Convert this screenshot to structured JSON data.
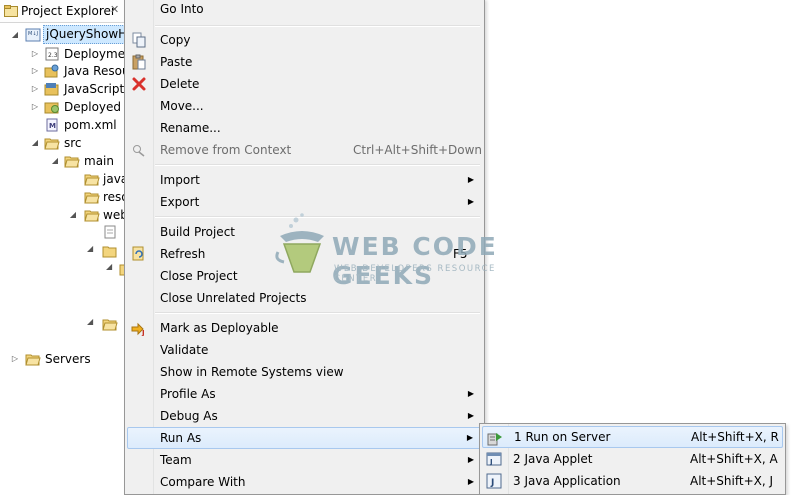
{
  "explorer": {
    "title": "Project Explorer",
    "close_glyph": "✕",
    "project": "jQueryShowHid",
    "nodes": {
      "deployment": "Deploymen",
      "java_resources": "Java Resour",
      "javascript": "JavaScript R",
      "deployed": "Deployed R",
      "pom": "pom.xml",
      "src": "src",
      "main": "main",
      "java": "java",
      "resources": "reso",
      "webapp": "web",
      "servers": "Servers"
    }
  },
  "menu": {
    "go_into": "Go Into",
    "copy": "Copy",
    "paste": "Paste",
    "delete": "Delete",
    "move": "Move...",
    "rename": "Rename...",
    "remove_from_context": "Remove from Context",
    "remove_shortcut": "Ctrl+Alt+Shift+Down",
    "import": "Import",
    "export": "Export",
    "build_project": "Build Project",
    "refresh": "Refresh",
    "refresh_shortcut": "F5",
    "close_project": "Close Project",
    "close_unrelated": "Close Unrelated Projects",
    "mark_deployable": "Mark as Deployable",
    "validate": "Validate",
    "show_remote": "Show in Remote Systems view",
    "profile_as": "Profile As",
    "debug_as": "Debug As",
    "run_as": "Run As",
    "team": "Team",
    "compare_with": "Compare With",
    "submenu_arrow": "▶"
  },
  "submenu": {
    "items": [
      {
        "label": "1 Run on Server",
        "shortcut": "Alt+Shift+X, R"
      },
      {
        "label": "2 Java Applet",
        "shortcut": "Alt+Shift+X, A"
      },
      {
        "label": "3 Java Application",
        "shortcut": "Alt+Shift+X, J"
      }
    ]
  },
  "watermark": {
    "title": "WEB CODE GEEKS",
    "subtitle": "WEB DEVELOPERS RESOURCE CENTER"
  },
  "colors": {
    "menu_bg": "#f0f0f0",
    "highlight": "#dcebfc",
    "selection": "#cde8ff",
    "delete_icon": "#d9322c",
    "folder": "#e8c15c"
  }
}
